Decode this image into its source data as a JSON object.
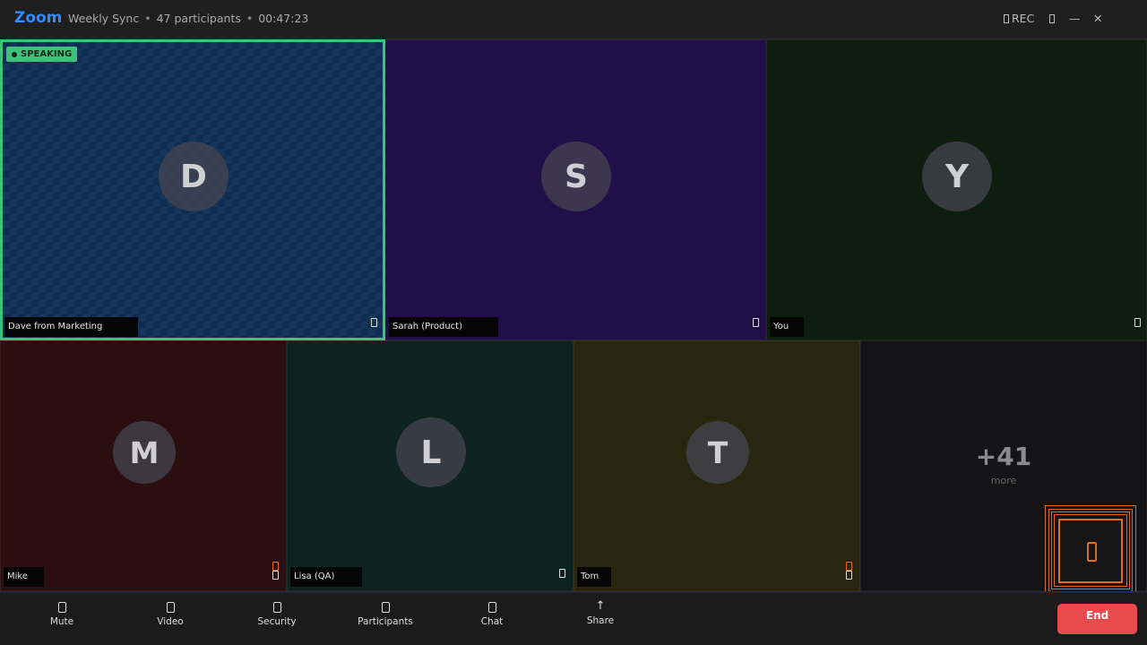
{
  "titlebar": {
    "brand": "Zoom",
    "meeting_name": "Weekly Sync",
    "participants_count": "47 participants",
    "elapsed": "00:47:23",
    "rec_label": "REC"
  },
  "tiles": [
    {
      "name": "Dave from Marketing",
      "initial": "D",
      "speaking": true
    },
    {
      "name": "Sarah (Product)",
      "initial": "S"
    },
    {
      "name": "You",
      "initial": "Y"
    },
    {
      "name": "Mike",
      "initial": "M"
    },
    {
      "name": "Lisa (QA)",
      "initial": "L"
    },
    {
      "name": "Tom",
      "initial": "T"
    }
  ],
  "speaking_label": "SPEAKING",
  "overflow": {
    "count": "+41",
    "label": "more"
  },
  "toolbar": {
    "mute": "Mute",
    "video": "Video",
    "security": "Security",
    "participants": "Participants",
    "chat": "Chat",
    "share": "Share",
    "end": "End"
  },
  "colors": {
    "accent": "#2d8cff",
    "speaking": "#3ec27a",
    "end": "#e84b4b",
    "warning": "#e06b1f"
  }
}
